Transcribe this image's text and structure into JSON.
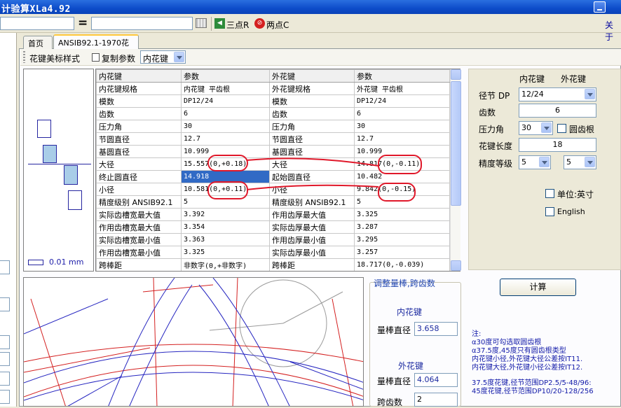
{
  "window": {
    "title": "计验算XLa4.92"
  },
  "toolbar": {
    "equals": "=",
    "three_point_label": "三点R",
    "two_point_label": "两点C",
    "about_label": "关于"
  },
  "tabs": [
    {
      "label": "首页"
    },
    {
      "label": "ANSIB92.1-1970花键"
    }
  ],
  "inner_toolbar": {
    "style_label": "花键美标样式",
    "copy_label": "复制参数",
    "type_selected": "内花键"
  },
  "preview": {
    "scale_label": "0.01 mm"
  },
  "table": {
    "headers": [
      "内花键",
      "参数",
      "外花键",
      "参数"
    ],
    "rows": [
      [
        "内花键规格",
        "内花键 平齿根",
        "外花键规格",
        "外花键 平齿根"
      ],
      [
        "模数",
        "DP12/24",
        "模数",
        "DP12/24"
      ],
      [
        "齿数",
        "6",
        "齿数",
        "6"
      ],
      [
        "压力角",
        "30",
        "压力角",
        "30"
      ],
      [
        "节圆直径",
        "12.7",
        "节圆直径",
        "12.7"
      ],
      [
        "基圆直径",
        "10.999",
        "基圆直径",
        "10.999"
      ],
      [
        "大径",
        "15.557(0,+0.18)",
        "大径",
        "14.817(0,-0.11)"
      ],
      [
        "终止圆直径",
        "14.918",
        "起始圆直径",
        "10.482"
      ],
      [
        "小径",
        "10.581(0,+0.11)",
        "小径",
        "9.842(0,-0.15)"
      ],
      [
        "精度级别 ANSIB92.1",
        "5",
        "精度级别 ANSIB92.1",
        "5"
      ],
      [
        "实际齿槽宽最大值",
        "3.392",
        "作用齿厚最大值",
        "3.325"
      ],
      [
        "作用齿槽宽最大值",
        "3.354",
        "实际齿厚最大值",
        "3.287"
      ],
      [
        "实际齿槽宽最小值",
        "3.363",
        "作用齿厚最小值",
        "3.295"
      ],
      [
        "作用齿槽宽最小值",
        "3.325",
        "实际齿厚最小值",
        "3.257"
      ],
      [
        "跨棒距",
        "非数字(0,+非数字)",
        "跨棒距",
        "18.717(0,-0.039)"
      ]
    ]
  },
  "right_panel": {
    "col_internal": "内花键",
    "col_external": "外花键",
    "dp_label": "径节 DP",
    "dp_value": "12/24",
    "teeth_label": "齿数",
    "teeth_value": "6",
    "pressure_label": "压力角",
    "pressure_value": "30",
    "root_round_label": "圆齿根",
    "length_label": "花键长度",
    "length_value": "18",
    "grade_label": "精度等级",
    "grade_internal": "5",
    "grade_external": "5",
    "unit_inch_label": "单位:英寸",
    "english_label": "English",
    "calc_label": "计算"
  },
  "gauge": {
    "title": "调整量棒,跨齿数",
    "internal_title": "内花键",
    "internal_pin_label": "量棒直径",
    "internal_pin_value": "3.658",
    "external_title": "外花键",
    "external_pin_label": "量棒直径",
    "external_pin_value": "4.064",
    "span_label": "跨齿数",
    "span_value": "2"
  },
  "notes": [
    "注:",
    "α30度可勾选取圆齿根",
    "α37.5度,45度只有圆齿根类型",
    "内花键小径,外花键大径公差按IT11.",
    "内花键大径,外花键小径公差按IT12.",
    "",
    "37.5度花键,径节范围DP2.5/5-48/96:",
    "45度花键,径节范围DP10/20-128/256"
  ],
  "colors": {
    "title_bar": "#0d4cc9",
    "selection": "#316ac5",
    "annotation_red": "#e0182a",
    "link_blue": "#1018a8"
  }
}
